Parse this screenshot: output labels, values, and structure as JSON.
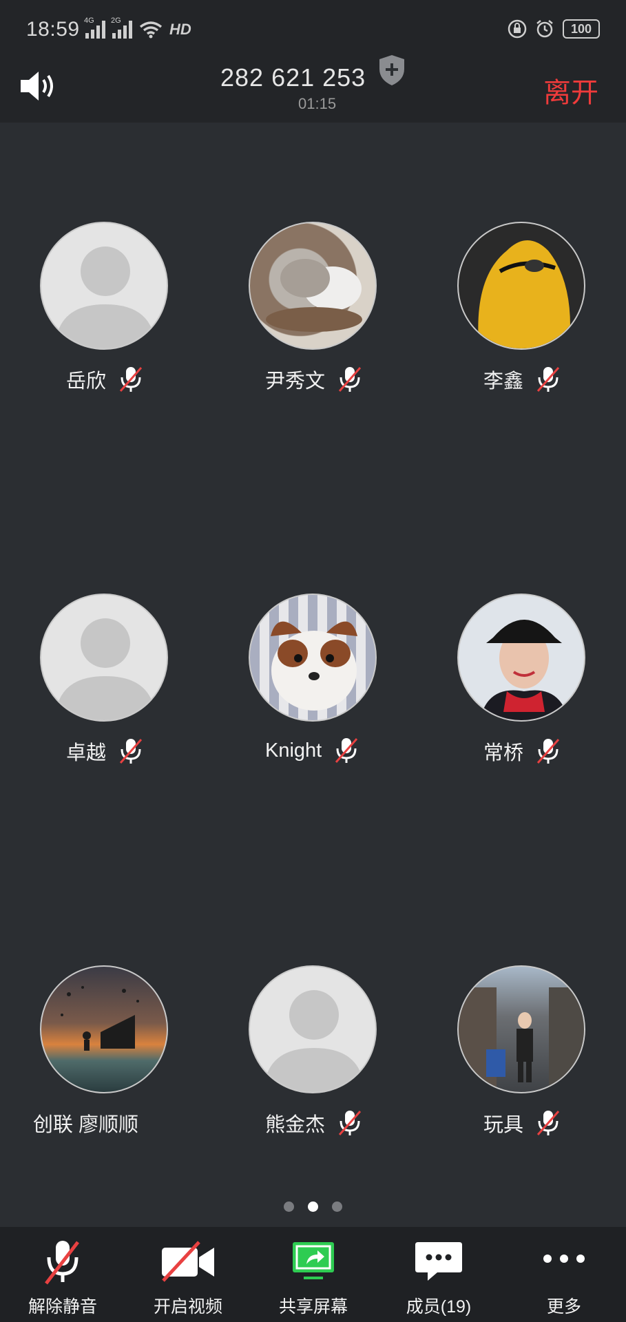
{
  "status_bar": {
    "time": "18:59",
    "signal1_label": "4G",
    "signal2_label": "2G",
    "hd_label": "HD",
    "battery": "100"
  },
  "header": {
    "meeting_id": "282 621 253",
    "timer": "01:15",
    "leave_label": "离开"
  },
  "participants": [
    {
      "name": "岳欣",
      "muted": true,
      "avatar": "default-avatar"
    },
    {
      "name": "尹秀文",
      "muted": true,
      "avatar": "cats-photo"
    },
    {
      "name": "李鑫",
      "muted": true,
      "avatar": "yellow-hood-photo"
    },
    {
      "name": "卓越",
      "muted": true,
      "avatar": "default-avatar"
    },
    {
      "name": "Knight",
      "muted": true,
      "avatar": "dog-photo"
    },
    {
      "name": "常桥",
      "muted": true,
      "avatar": "woman-cap-photo"
    },
    {
      "name": "创联 廖顺顺",
      "muted": false,
      "avatar": "piano-sunset-photo"
    },
    {
      "name": "熊金杰",
      "muted": true,
      "avatar": "default-avatar"
    },
    {
      "name": "玩具",
      "muted": true,
      "avatar": "street-photo"
    }
  ],
  "pagination": {
    "pages": 3,
    "current": 2
  },
  "toolbar": {
    "unmute_label": "解除静音",
    "video_label": "开启视频",
    "share_label": "共享屏幕",
    "members_label": "成员(19)",
    "more_label": "更多"
  },
  "colors": {
    "background": "#2b2e32",
    "header": "#232528",
    "toolbar": "#1f2124",
    "leave": "#ef3b3b",
    "share_green": "#2ecc52",
    "mute_slash": "#e84141"
  }
}
